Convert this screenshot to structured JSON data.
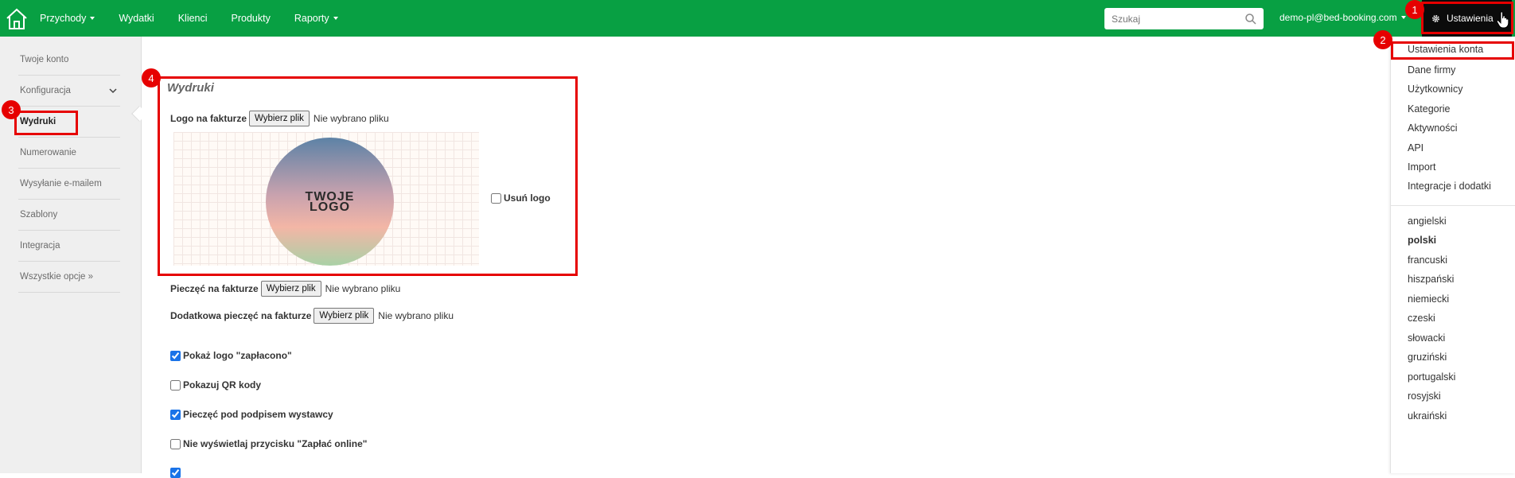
{
  "topbar": {
    "nav": [
      {
        "label": "Przychody",
        "has_caret": true
      },
      {
        "label": "Wydatki",
        "has_caret": false
      },
      {
        "label": "Klienci",
        "has_caret": false
      },
      {
        "label": "Produkty",
        "has_caret": false
      },
      {
        "label": "Raporty",
        "has_caret": true
      }
    ],
    "search_placeholder": "Szukaj",
    "user": "demo-pl@bed-booking.com",
    "settings_label": "Ustawienia",
    "accent_color": "#08a043"
  },
  "sidebar": {
    "items": [
      {
        "label": "Twoje konto"
      },
      {
        "label": "Konfiguracja"
      },
      {
        "label": "Wydruki"
      },
      {
        "label": "Numerowanie"
      },
      {
        "label": "Wysyłanie e-mailem"
      },
      {
        "label": "Szablony"
      },
      {
        "label": "Integracja"
      },
      {
        "label": "Wszystkie opcje »"
      }
    ]
  },
  "main": {
    "section_title": "Wydruki",
    "logo_label": "Logo na fakturze",
    "stamp_label": "Pieczęć na fakturze",
    "extra_stamp_label": "Dodatkowa pieczęć na fakturze",
    "choose_file": "Wybierz plik",
    "no_file": "Nie wybrano pliku",
    "logo_text_1": "TWOJE",
    "logo_text_2": "LOGO",
    "delete_logo": "Usuń logo",
    "checkboxes": [
      {
        "label": "Pokaż logo \"zapłacono\"",
        "checked": true
      },
      {
        "label": "Pokazuj QR kody",
        "checked": false
      },
      {
        "label": "Pieczęć pod podpisem wystawcy",
        "checked": true
      },
      {
        "label": "Nie wyświetlaj przycisku \"Zapłać online\"",
        "checked": false
      }
    ]
  },
  "dropdown": {
    "items": [
      "Ustawienia konta",
      "Dane firmy",
      "Użytkownicy",
      "Kategorie",
      "Aktywności",
      "API",
      "Import",
      "Integracje i dodatki"
    ],
    "languages": [
      "angielski",
      "polski",
      "francuski",
      "hiszpański",
      "niemiecki",
      "czeski",
      "słowacki",
      "gruziński",
      "portugalski",
      "rosyjski",
      "ukraiński"
    ],
    "active_language": "polski"
  },
  "annotations": {
    "markers": [
      "1",
      "2",
      "3",
      "4"
    ]
  }
}
